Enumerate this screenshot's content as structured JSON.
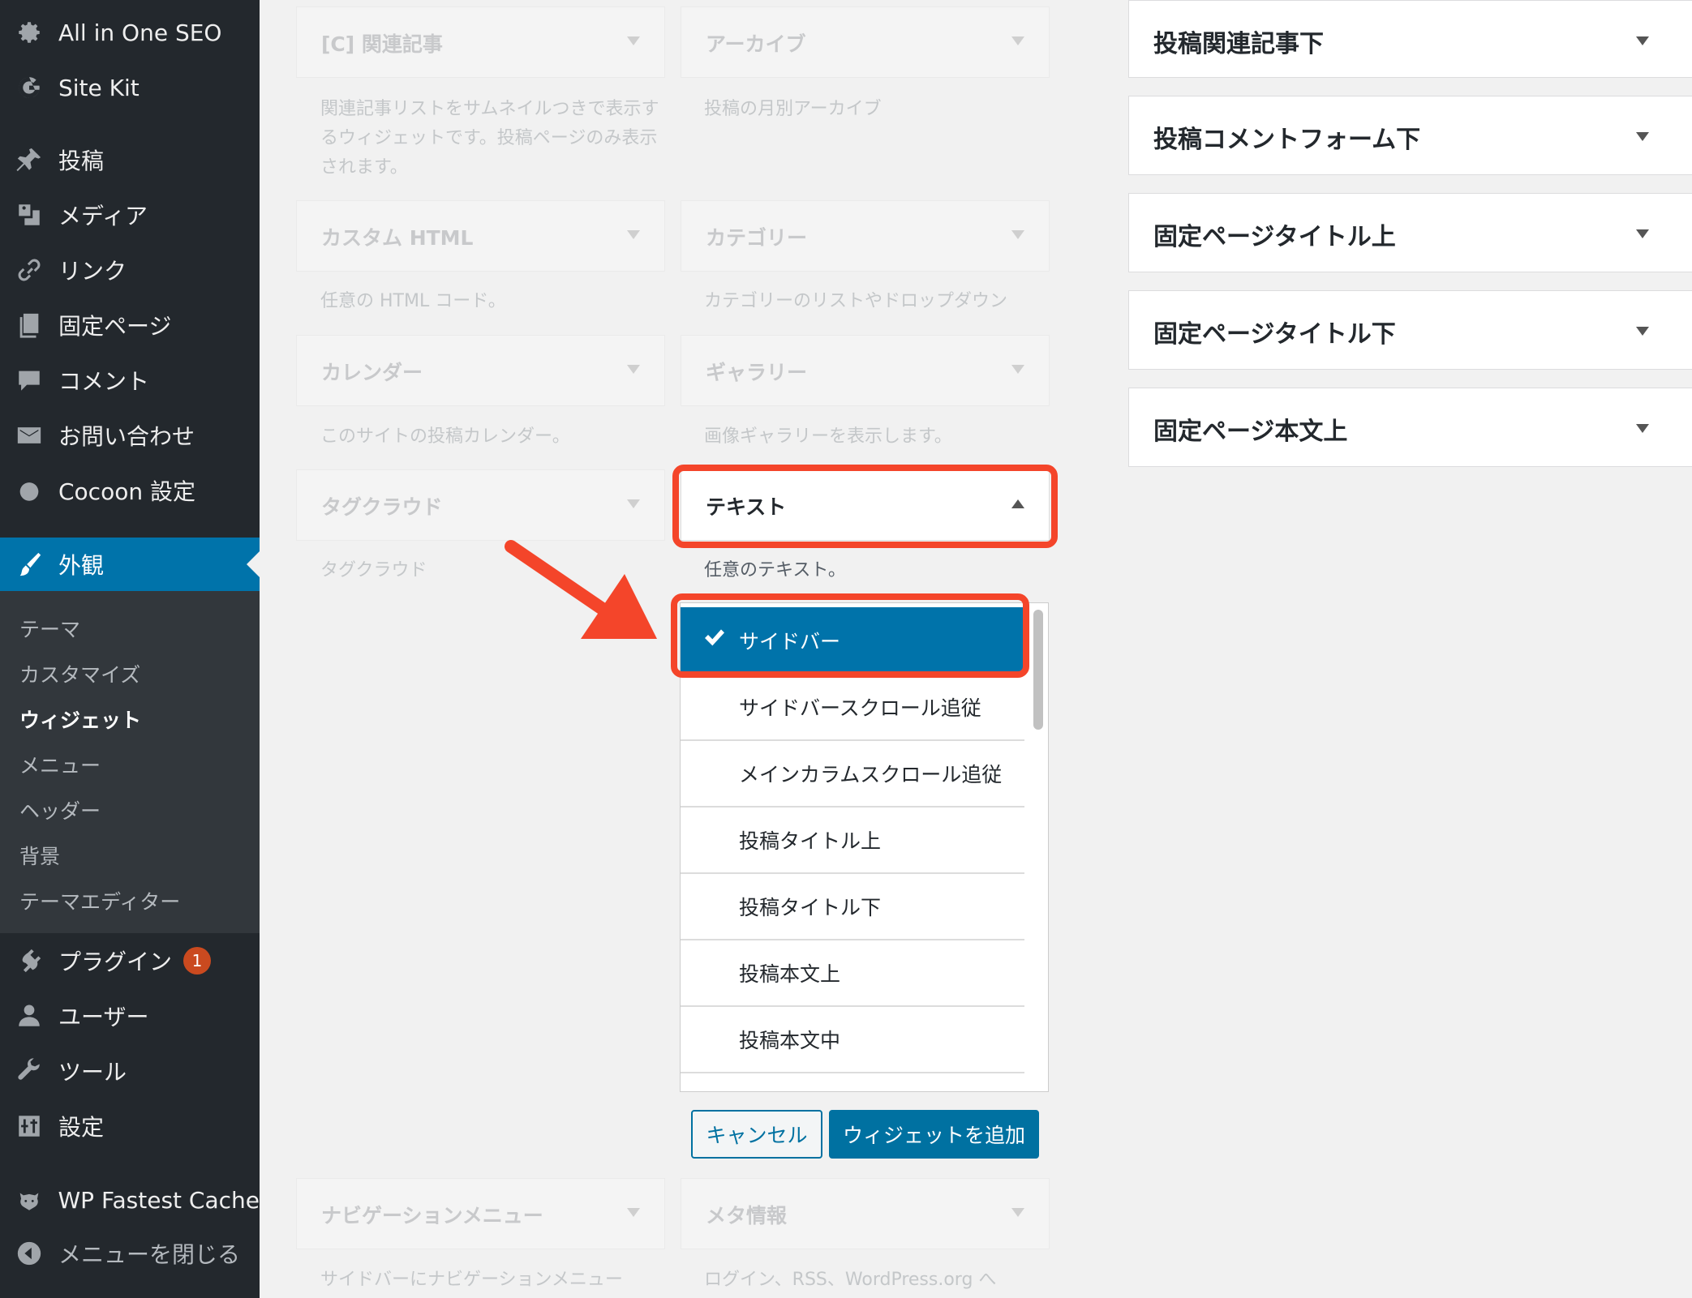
{
  "admin_menu": {
    "top_items": [
      {
        "label": "All in One SEO",
        "icon": "gear-icon"
      },
      {
        "label": "Site Kit",
        "icon": "google-g-icon"
      }
    ],
    "items": [
      {
        "label": "投稿",
        "icon": "pin-icon"
      },
      {
        "label": "メディア",
        "icon": "media-icon"
      },
      {
        "label": "リンク",
        "icon": "link-icon"
      },
      {
        "label": "固定ページ",
        "icon": "pages-icon"
      },
      {
        "label": "コメント",
        "icon": "comment-icon"
      },
      {
        "label": "お問い合わせ",
        "icon": "mail-icon"
      },
      {
        "label": "Cocoon 設定",
        "icon": "circle-icon"
      }
    ],
    "current": {
      "label": "外観",
      "icon": "brush-icon"
    },
    "submenu": [
      "テーマ",
      "カスタマイズ",
      "ウィジェット",
      "メニュー",
      "ヘッダー",
      "背景",
      "テーマエディター"
    ],
    "submenu_current": "ウィジェット",
    "after_items": [
      {
        "label": "プラグイン",
        "icon": "plugin-icon",
        "badge": "1"
      },
      {
        "label": "ユーザー",
        "icon": "user-icon"
      },
      {
        "label": "ツール",
        "icon": "wrench-icon"
      },
      {
        "label": "設定",
        "icon": "settings-icon"
      }
    ],
    "wp_fastest_cache": {
      "label": "WP Fastest Cache",
      "icon": "cheetah-icon"
    },
    "collapse": {
      "label": "メニューを閉じる",
      "icon": "collapse-icon"
    }
  },
  "available_widgets": [
    {
      "title": "[C] 関連記事",
      "desc": "関連記事リストをサムネイルつきで表示するウィジェットです。投稿ページのみ表示されます。"
    },
    {
      "title": "アーカイブ",
      "desc": "投稿の月別アーカイブ"
    },
    {
      "title": "カスタム HTML",
      "desc": "任意の HTML コード。"
    },
    {
      "title": "カテゴリー",
      "desc": "カテゴリーのリストやドロップダウン"
    },
    {
      "title": "カレンダー",
      "desc": "このサイトの投稿カレンダー。"
    },
    {
      "title": "ギャラリー",
      "desc": "画像ギャラリーを表示します。"
    },
    {
      "title": "タグクラウド",
      "desc": "タグクラウド"
    },
    {
      "title": "テキスト",
      "desc": "任意のテキスト。"
    },
    {
      "title": "ナビゲーションメニュー",
      "desc": "サイドバーにナビゲーションメニュー"
    },
    {
      "title": "メタ情報",
      "desc": "ログイン、RSS、WordPress.org へ"
    }
  ],
  "sidebar_chooser": {
    "options": [
      "サイドバー",
      "サイドバースクロール追従",
      "メインカラムスクロール追従",
      "投稿タイトル上",
      "投稿タイトル下",
      "投稿本文上",
      "投稿本文中"
    ],
    "selected": "サイドバー",
    "cancel_label": "キャンセル",
    "add_label": "ウィジェットを追加"
  },
  "widget_areas": [
    "投稿関連記事下",
    "投稿コメントフォーム下",
    "固定ページタイトル上",
    "固定ページタイトル下",
    "固定ページ本文上"
  ],
  "colors": {
    "accent": "#0073aa",
    "highlight": "#f4452a",
    "sidebar_bg": "#23282d",
    "badge": "#ca4a1f"
  }
}
